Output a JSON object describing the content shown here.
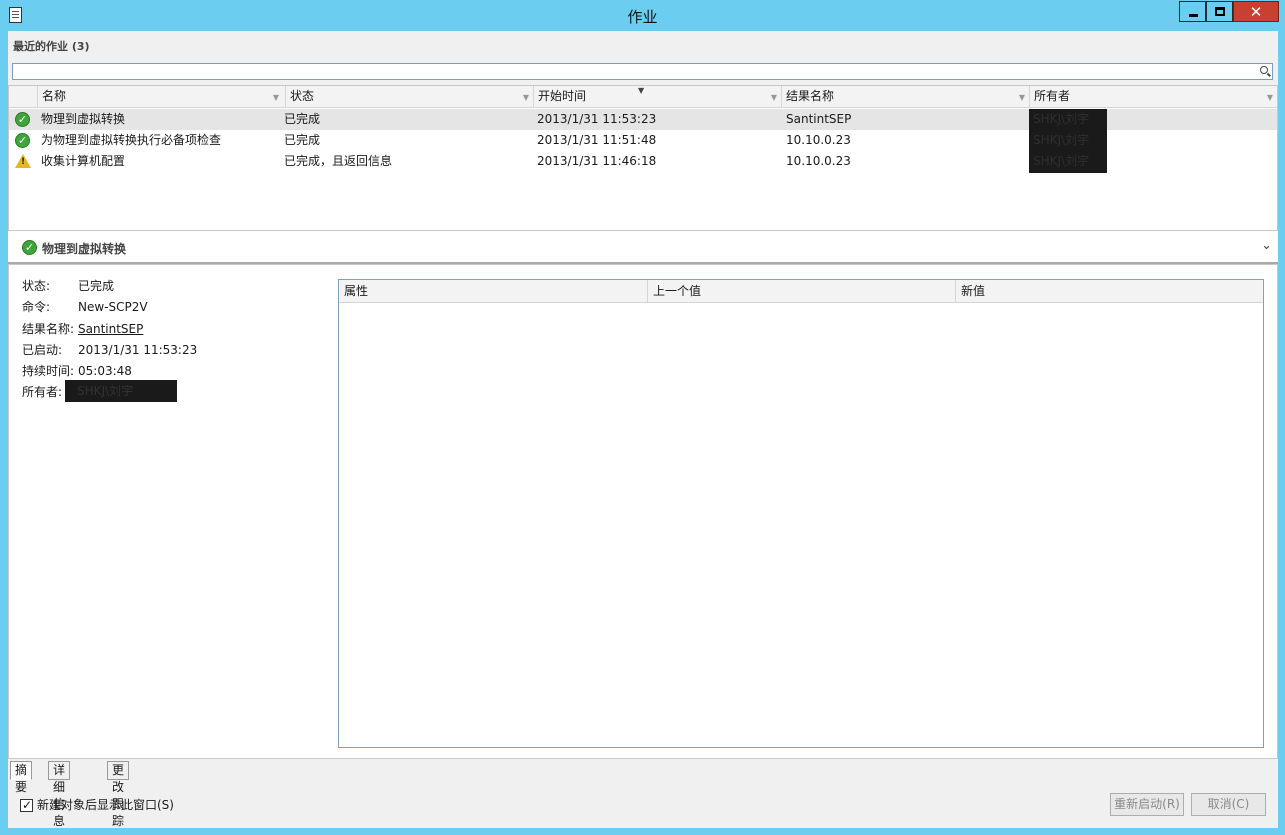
{
  "window": {
    "title": "作业"
  },
  "section": {
    "title": "最近的作业 (3)"
  },
  "search": {
    "placeholder": ""
  },
  "grid": {
    "columns": [
      "名称",
      "状态",
      "开始时间",
      "结果名称",
      "所有者"
    ],
    "rows": [
      {
        "icon": "success-icon",
        "name": "物理到虚拟转换",
        "status": "已完成",
        "start": "2013/1/31 11:53:23",
        "result": "SantintSEP",
        "owner": "SHKJ\\刘宇"
      },
      {
        "icon": "success-icon",
        "name": "为物理到虚拟转换执行必备项检查",
        "status": "已完成",
        "start": "2013/1/31 11:51:48",
        "result": "10.10.0.23",
        "owner": "SHKJ\\刘宇"
      },
      {
        "icon": "warning-icon",
        "name": "收集计算机配置",
        "status": "已完成，且返回信息",
        "start": "2013/1/31 11:46:18",
        "result": "10.10.0.23",
        "owner": "SHKJ\\刘宇"
      }
    ]
  },
  "detail": {
    "title": "物理到虚拟转换",
    "fields": [
      {
        "label": "状态:",
        "value": "已完成"
      },
      {
        "label": "命令:",
        "value": "New-SCP2V"
      },
      {
        "label": "结果名称:",
        "value": "SantintSEP"
      },
      {
        "label": "已启动:",
        "value": "2013/1/31 11:53:23"
      },
      {
        "label": "持续时间:",
        "value": "05:03:48"
      },
      {
        "label": "所有者:",
        "value": "SHKJ\\刘宇"
      }
    ],
    "prop_columns": [
      "属性",
      "上一个值",
      "新值"
    ]
  },
  "tabs": [
    "摘要",
    "详细信息",
    "更改跟踪"
  ],
  "footer": {
    "checkbox_label": "新建对象后显示此窗口(S)",
    "restart_label": "重新启动(R)",
    "cancel_label": "取消(C)"
  },
  "colors": {
    "titlebar": "#6bcdf0",
    "close": "#c84031",
    "success": "#3fa53a",
    "warning": "#e5b722",
    "link": "#2a61c2"
  }
}
